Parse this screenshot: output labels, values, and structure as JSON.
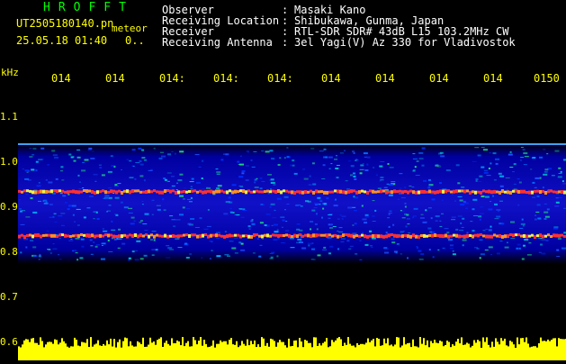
{
  "header": {
    "app_title": "HROFFT",
    "file_name": "UT2505180140.pn",
    "meteor_label": "meteor",
    "timestamp": "25.05.18 01:40",
    "count": "0.."
  },
  "info": [
    {
      "label": "Observer",
      "value": "Masaki Kano"
    },
    {
      "label": "Receiving Location",
      "value": "Shibukawa, Gunma, Japan"
    },
    {
      "label": "Receiver",
      "value": "RTL-SDR SDR# 43dB L15 103.2MHz CW"
    },
    {
      "label": "Receiving Antenna",
      "value": "3el Yagi(V) Az 330 for Vladivostok"
    }
  ],
  "axis": {
    "unit": "kHz",
    "y_ticks": [
      "1.1",
      "1.0",
      "0.9",
      "0.8",
      "0.7",
      "0.6"
    ],
    "x_ticks": [
      "014",
      "014",
      "014:",
      "014:",
      "014:",
      "014",
      "014",
      "014",
      "014",
      "0150"
    ]
  },
  "colors": {
    "title": "#00ff00",
    "text": "#ffffff",
    "label": "#ffff00",
    "background": "#00007a",
    "signal": "#ff3030",
    "bars": "#ffff00"
  }
}
